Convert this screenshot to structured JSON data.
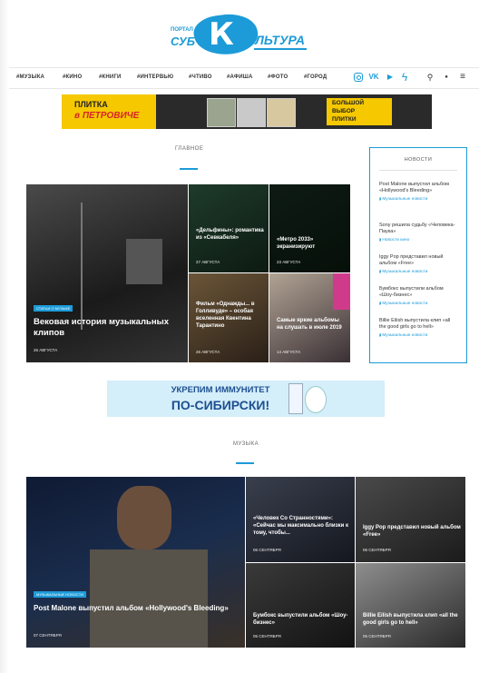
{
  "logo": {
    "portal": "ПОРТАЛ",
    "sub": "СУБ",
    "k": "К",
    "ultura": "УЛЬТУРА"
  },
  "nav": {
    "items": [
      "#МУЗЫКА",
      "#КИНО",
      "#КНИГИ",
      "#ИНТЕРВЬЮ",
      "#ЧТИВО",
      "#АФИША",
      "#ФОТО",
      "#ГОРОД"
    ],
    "icons": [
      "instagram-icon",
      "vk-icon",
      "youtube-icon",
      "lightning-icon",
      "search-icon",
      "user-icon",
      "menu-icon"
    ],
    "icon_glyphs": {
      "vk": "VK",
      "youtube": "▶",
      "lightning": "ϟ",
      "search": "⚲",
      "user": "●",
      "menu": "≡"
    }
  },
  "banner_top": {
    "line1": "ПЛИТКА",
    "line2": "в ПЕТРОВИЧЕ",
    "right1": "БОЛЬШОЙ",
    "right2": "ВЫБОР",
    "right3": "ПЛИТКИ"
  },
  "main_section": {
    "title": "ГЛАВНОЕ"
  },
  "features": [
    {
      "tag": "СТАТЬИ О МУЗЫКЕ",
      "title": "Вековая история музыкальных клипов",
      "date": "26 АВГУСТА"
    },
    {
      "title": "«Дельфины»: романтика из «Севкабеля»",
      "date": "27 АВГУСТА"
    },
    {
      "title": "«Метро 2033» экранизируют",
      "date": "23 АВГУСТА"
    },
    {
      "title": "Фильм «Однажды... в Голливуде» – особая вселенная Квентина Тарантино",
      "date": "26 АВГУСТА"
    },
    {
      "title": "Самые яркие альбомы на слушать в июле 2019",
      "date": "14 АВГУСТА"
    }
  ],
  "news": {
    "title": "НОВОСТИ",
    "items": [
      {
        "headline": "Post Malone выпустил альбом «Hollywood's Bleeding»",
        "category": "Музыкальные новости"
      },
      {
        "headline": "Sony решила судьбу «Человека-Паука»",
        "category": "Новости кино"
      },
      {
        "headline": "Iggy Pop представил новый альбом «Free»",
        "category": "Музыкальные новости"
      },
      {
        "headline": "Бумбокс выпустили альбом «Шоу-бизнес»",
        "category": "Музыкальные новости"
      },
      {
        "headline": "Billie Eilish выпустила клип «all the good girls go to hell»",
        "category": "Музыкальные новости"
      }
    ]
  },
  "banner_mid": {
    "line1": "УКРЕПИМ ИММУНИТЕТ",
    "line2": "ПО-СИБИРСКИ!"
  },
  "music_section": {
    "title": "МУЗЫКА"
  },
  "music": [
    {
      "tag": "МУЗЫКАЛЬНЫЕ НОВОСТИ",
      "title": "Post Malone выпустил альбом «Hollywood's Bleeding»",
      "date": "07 СЕНТЯБРЯ"
    },
    {
      "title": "«Человек Со Странностями»: «Сейчас мы максимально близки к тому, чтобы...",
      "date": "06 СЕНТЯБРЯ"
    },
    {
      "title": "Iggy Pop представил новый альбом «Free»",
      "date": "06 СЕНТЯБРЯ"
    },
    {
      "title": "Бумбокс выпустили альбом «Шоу-бизнес»",
      "date": "05 СЕНТЯБРЯ"
    },
    {
      "title": "Billie Eilish выпустила клип «all the good girls go to hell»",
      "date": "05 СЕНТЯБРЯ"
    }
  ]
}
